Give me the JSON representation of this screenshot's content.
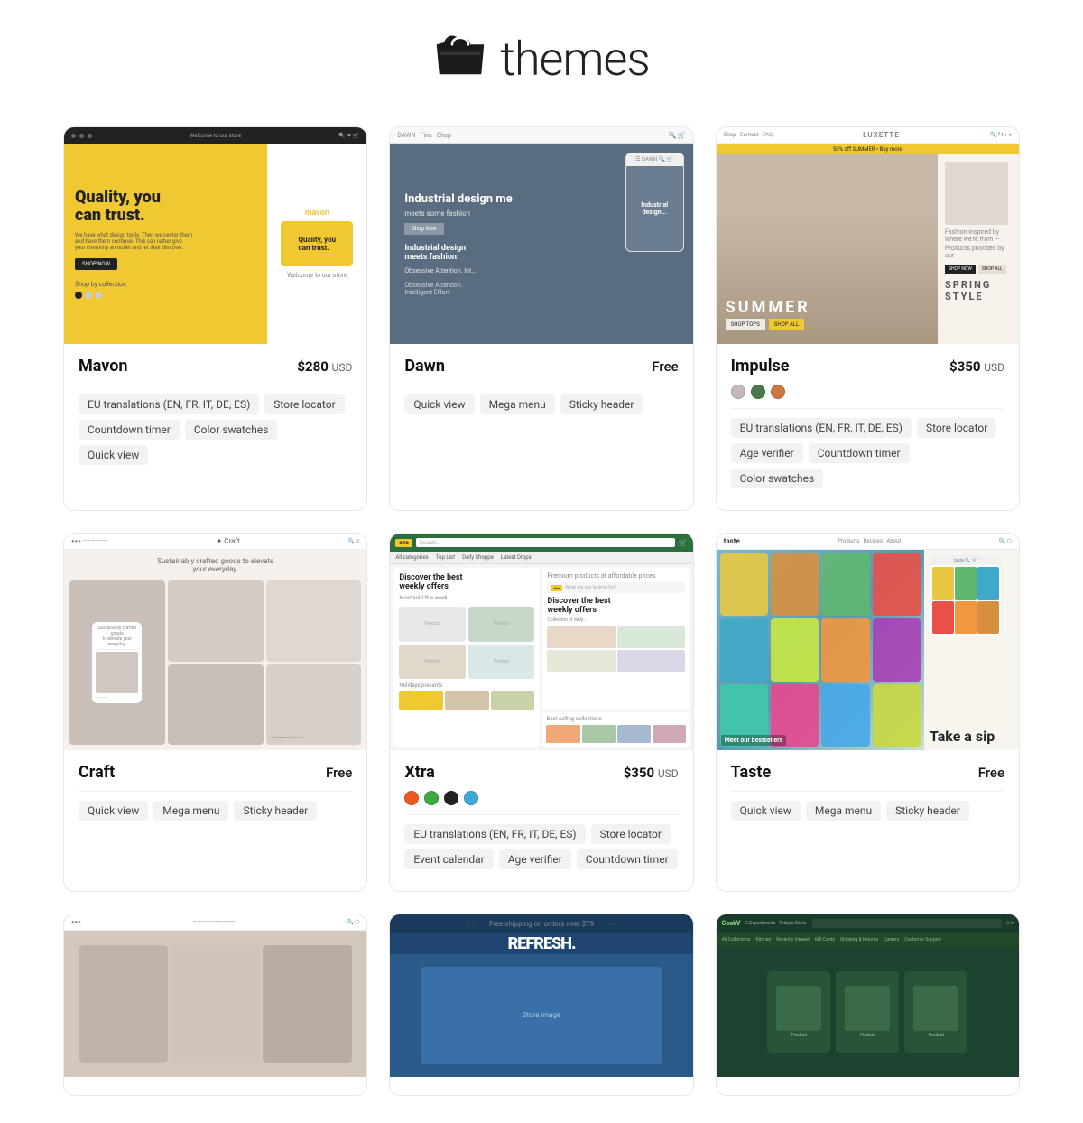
{
  "header": {
    "title": "themes"
  },
  "themes": [
    {
      "id": "mavon",
      "name": "Mavon",
      "price": "$280",
      "currency": "USD",
      "is_free": false,
      "tags_row1": [
        "EU translations (EN, FR, IT, DE, ES)",
        "Store locator"
      ],
      "tags_row2": [
        "Countdown timer",
        "Color swatches",
        "Quick view"
      ],
      "swatches": []
    },
    {
      "id": "dawn",
      "name": "Dawn",
      "price": "",
      "currency": "",
      "is_free": true,
      "tags_row1": [
        "Quick view",
        "Mega menu",
        "Sticky header"
      ],
      "tags_row2": [],
      "swatches": []
    },
    {
      "id": "impulse",
      "name": "Impulse",
      "price": "$350",
      "currency": "USD",
      "is_free": false,
      "tags_row1": [
        "EU translations (EN, FR, IT, DE, ES)",
        "Store locator"
      ],
      "tags_row2": [
        "Age verifier",
        "Countdown timer",
        "Color swatches"
      ],
      "swatches": [
        "#c8b8b8",
        "#4a7a4a",
        "#c87840"
      ]
    },
    {
      "id": "craft",
      "name": "Craft",
      "price": "",
      "currency": "",
      "is_free": true,
      "tags_row1": [
        "Quick view",
        "Mega menu",
        "Sticky header"
      ],
      "tags_row2": [],
      "swatches": []
    },
    {
      "id": "xtra",
      "name": "Xtra",
      "price": "$350",
      "currency": "USD",
      "is_free": false,
      "tags_row1": [
        "EU translations (EN, FR, IT, DE, ES)",
        "Store locator"
      ],
      "tags_row2": [
        "Event calendar",
        "Age verifier",
        "Countdown timer"
      ],
      "swatches": [
        "#e85a20",
        "#40a840",
        "#222222",
        "#40a8d8"
      ]
    },
    {
      "id": "taste",
      "name": "Taste",
      "price": "",
      "currency": "",
      "is_free": true,
      "tags_row1": [
        "Quick view",
        "Mega menu",
        "Sticky header"
      ],
      "tags_row2": [],
      "swatches": []
    },
    {
      "id": "bottom1",
      "name": "",
      "price": "",
      "currency": "",
      "is_free": false,
      "tags_row1": [],
      "tags_row2": [],
      "swatches": []
    },
    {
      "id": "bottom2",
      "name": "",
      "price": "",
      "currency": "",
      "is_free": false,
      "tags_row1": [],
      "tags_row2": [],
      "swatches": []
    },
    {
      "id": "bottom3",
      "name": "",
      "price": "",
      "currency": "",
      "is_free": false,
      "tags_row1": [],
      "tags_row2": [],
      "swatches": []
    }
  ],
  "labels": {
    "free": "Free",
    "usd": "USD"
  }
}
